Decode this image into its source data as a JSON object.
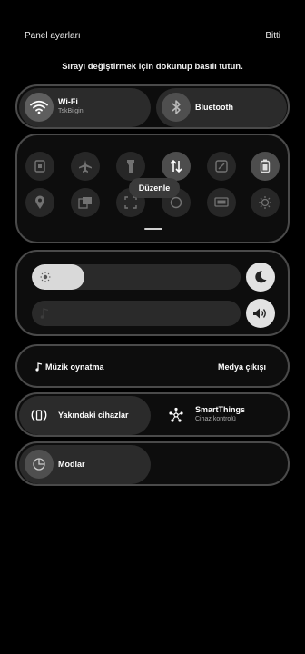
{
  "header": {
    "title": "Panel ayarları",
    "done": "Bitti"
  },
  "hint": "Sırayı değiştirmek için dokunup basılı tutun.",
  "wifi": {
    "label": "Wi-Fi",
    "network": "TskBilgin"
  },
  "bluetooth": {
    "label": "Bluetooth"
  },
  "edit_label": "Düzenle",
  "brightness": {
    "level": 0.25
  },
  "volume": {
    "level": 0.0
  },
  "media": {
    "music_label": "Müzik oynatma",
    "output_label": "Medya çıkışı"
  },
  "nearby": {
    "label": "Yakındaki cihazlar"
  },
  "smartthings": {
    "label": "SmartThings",
    "sub": "Cihaz kontrolü"
  },
  "modes": {
    "label": "Modlar"
  },
  "colors": {
    "background": "#000000",
    "card_border": "#4a4a4a",
    "tile": "#2b2b2b",
    "slider_fill": "#d9d9d9"
  }
}
